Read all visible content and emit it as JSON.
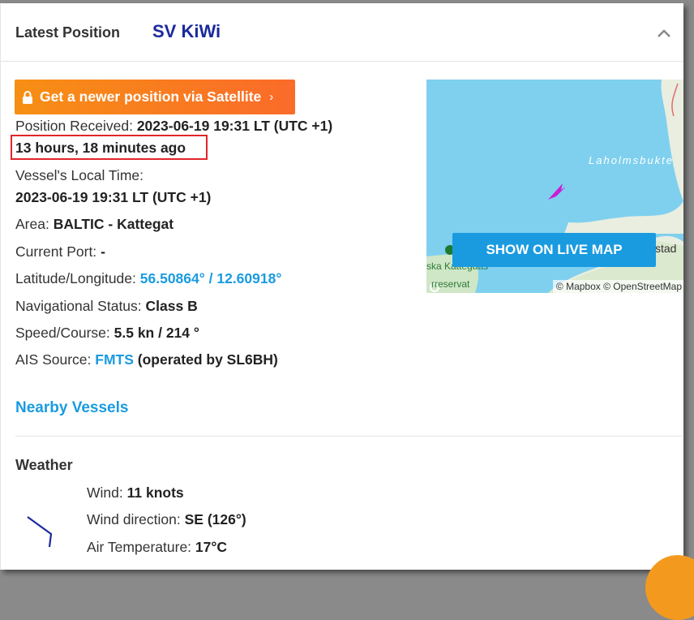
{
  "header": {
    "title": "Latest Position",
    "vessel_name": "SV KiWi",
    "collapse_icon": "chevron-up-icon"
  },
  "satellite_button": {
    "label": "Get a newer position via Satellite",
    "lock_icon": "lock-icon",
    "arrow": "›"
  },
  "position": {
    "received_label": "Position Received:",
    "received_value": "2023-06-19 19:31 LT (UTC +1)",
    "ago": "13 hours, 18 minutes ago",
    "local_time_label": "Vessel's Local Time:",
    "local_time_value": "2023-06-19 19:31 LT (UTC +1)",
    "area_label": "Area:",
    "area_value": "BALTIC - Kattegat",
    "port_label": "Current Port:",
    "port_value": "-",
    "latlon_label": "Latitude/Longitude:",
    "latlon_value": "56.50864° / 12.60918°",
    "nav_label": "Navigational Status:",
    "nav_value": "Class B",
    "speed_label": "Speed/Course:",
    "speed_value": "5.5 kn / 214 °",
    "ais_label": "AIS Source:",
    "ais_link": "FMTS",
    "ais_suffix": "(operated by SL6BH)"
  },
  "nearby_vessels": "Nearby Vessels",
  "map": {
    "bay_label": "Laholmsbukte",
    "place_label": "stad",
    "reserve_label_1": "ska Kattegatts",
    "reserve_label_2": "rreservat",
    "live_button": "SHOW ON LIVE MAP",
    "attribution": "© Mapbox © OpenStreetMap",
    "water_color": "#7fd0ee",
    "land_color": "#e9eee0",
    "vessel_color": "#c81fd6"
  },
  "weather": {
    "heading": "Weather",
    "wind_label": "Wind:",
    "wind_value": "11 knots",
    "direction_label": "Wind direction:",
    "direction_value": "SE (126°)",
    "temp_label": "Air Temperature:",
    "temp_value": "17°C"
  }
}
